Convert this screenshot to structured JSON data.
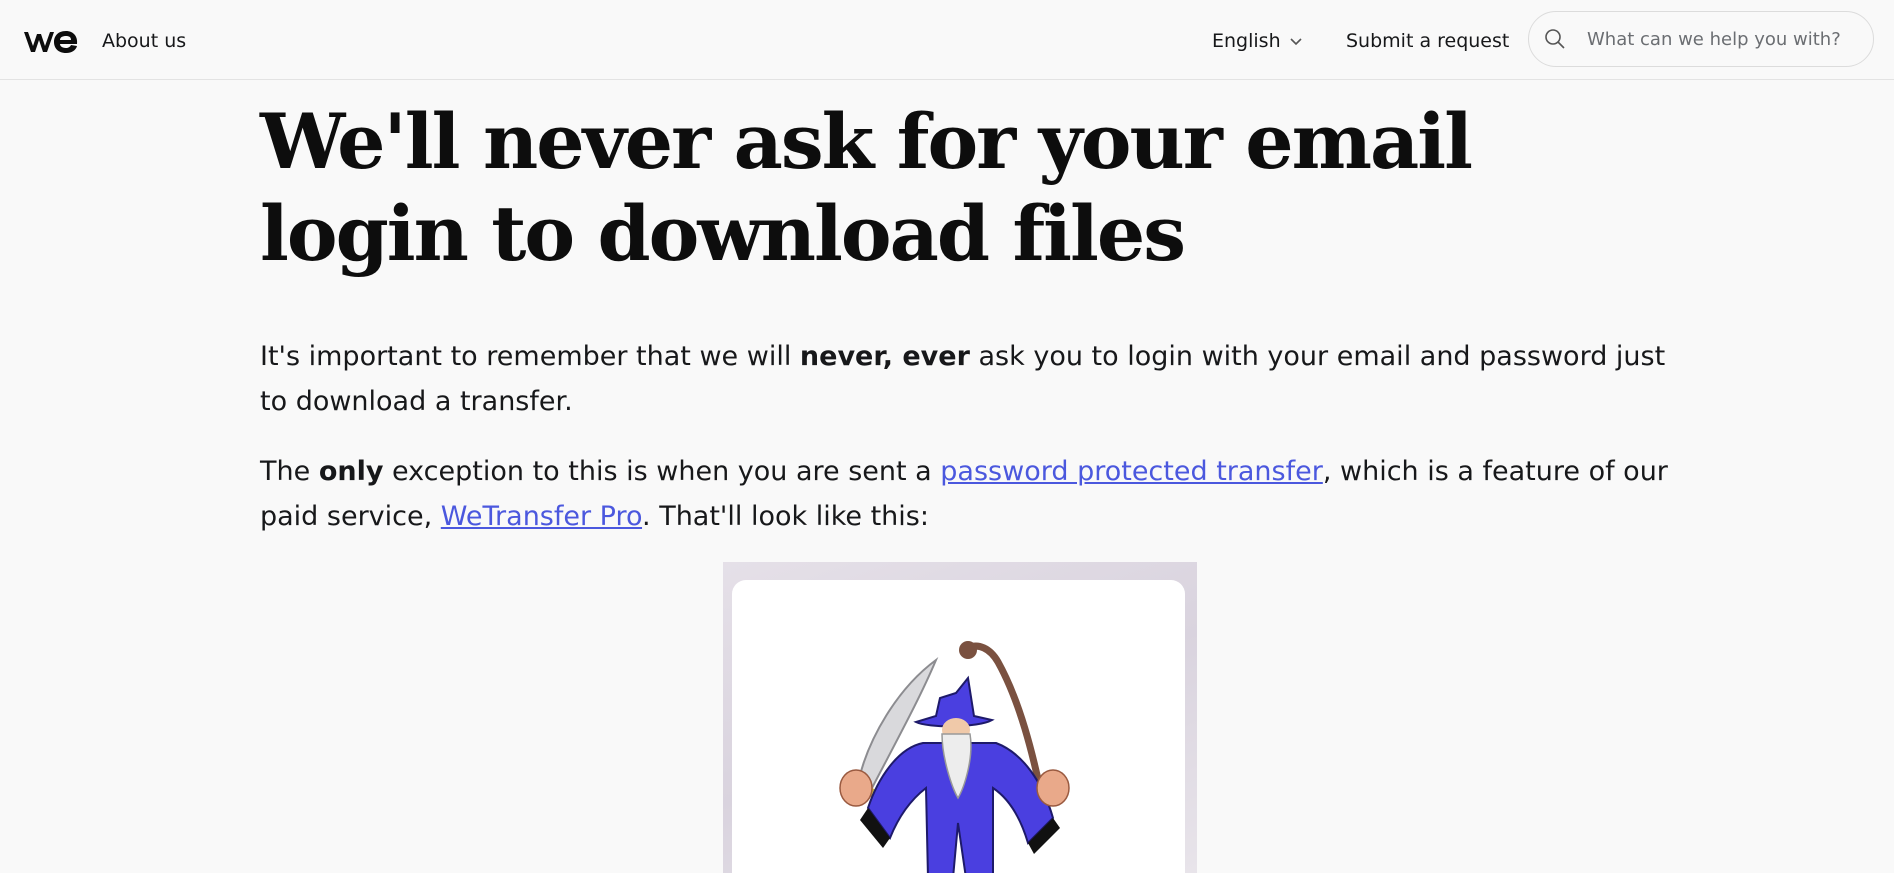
{
  "header": {
    "logo_name": "we-logo",
    "about_label": "About us",
    "language_label": "English",
    "submit_label": "Submit a request",
    "search": {
      "placeholder": "What can we help you with?",
      "value": ""
    }
  },
  "article": {
    "title": "We'll never ask for your email login to download files",
    "p1": {
      "before": "It's important to remember that we will ",
      "bold": "never, ever",
      "after": " ask you to login with your email and password just to download a transfer."
    },
    "p2": {
      "t1": "The ",
      "bold": "only",
      "t2": " exception to this is when you are sent a ",
      "link1": "password protected transfer",
      "t3": ", which is a feature of our paid service, ",
      "link2": "WeTransfer Pro",
      "t4": ". That'll look like this:"
    },
    "image_alt": "wizard-illustration"
  },
  "colors": {
    "link": "#4b58de",
    "wizard_robe": "#4a3fe0",
    "background": "#f9f9f9"
  }
}
